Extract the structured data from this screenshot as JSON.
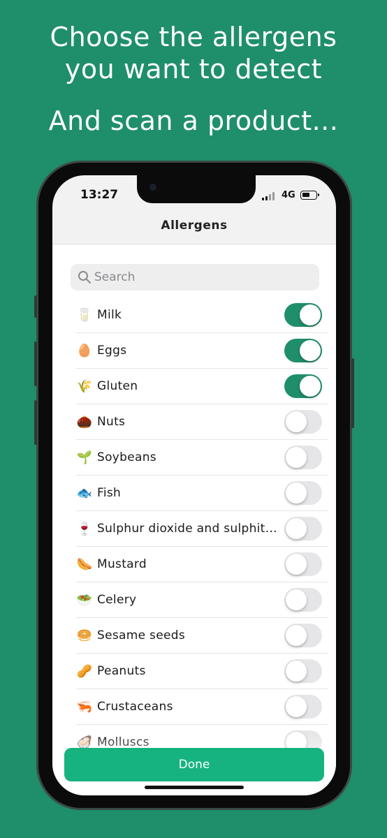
{
  "headline": {
    "line1": "Choose the allergens",
    "line1b": "you want to detect",
    "line2": "And scan a product..."
  },
  "status_bar": {
    "time": "13:27",
    "network": "4G"
  },
  "nav": {
    "title": "Allergens"
  },
  "search": {
    "placeholder": "Search",
    "icon": "magnifier-icon"
  },
  "allergens": [
    {
      "emoji": "🥛",
      "label": "Milk",
      "enabled": true
    },
    {
      "emoji": "🥚",
      "label": "Eggs",
      "enabled": true
    },
    {
      "emoji": "🌾",
      "label": "Gluten",
      "enabled": true
    },
    {
      "emoji": "🌰",
      "label": "Nuts",
      "enabled": false
    },
    {
      "emoji": "🌱",
      "label": "Soybeans",
      "enabled": false
    },
    {
      "emoji": "🐟",
      "label": "Fish",
      "enabled": false
    },
    {
      "emoji": "🍷",
      "label": "Sulphur dioxide and sulphites",
      "enabled": false
    },
    {
      "emoji": "🌭",
      "label": "Mustard",
      "enabled": false
    },
    {
      "emoji": "🥗",
      "label": "Celery",
      "enabled": false
    },
    {
      "emoji": "🥯",
      "label": "Sesame seeds",
      "enabled": false
    },
    {
      "emoji": "🥜",
      "label": "Peanuts",
      "enabled": false
    },
    {
      "emoji": "🦐",
      "label": "Crustaceans",
      "enabled": false
    },
    {
      "emoji": "🦪",
      "label": "Molluscs",
      "enabled": false
    }
  ],
  "done_button": {
    "label": "Done"
  },
  "colors": {
    "background": "#1f8e6b",
    "toggle_on": "#1f8e6b",
    "done_button": "#16b380"
  }
}
